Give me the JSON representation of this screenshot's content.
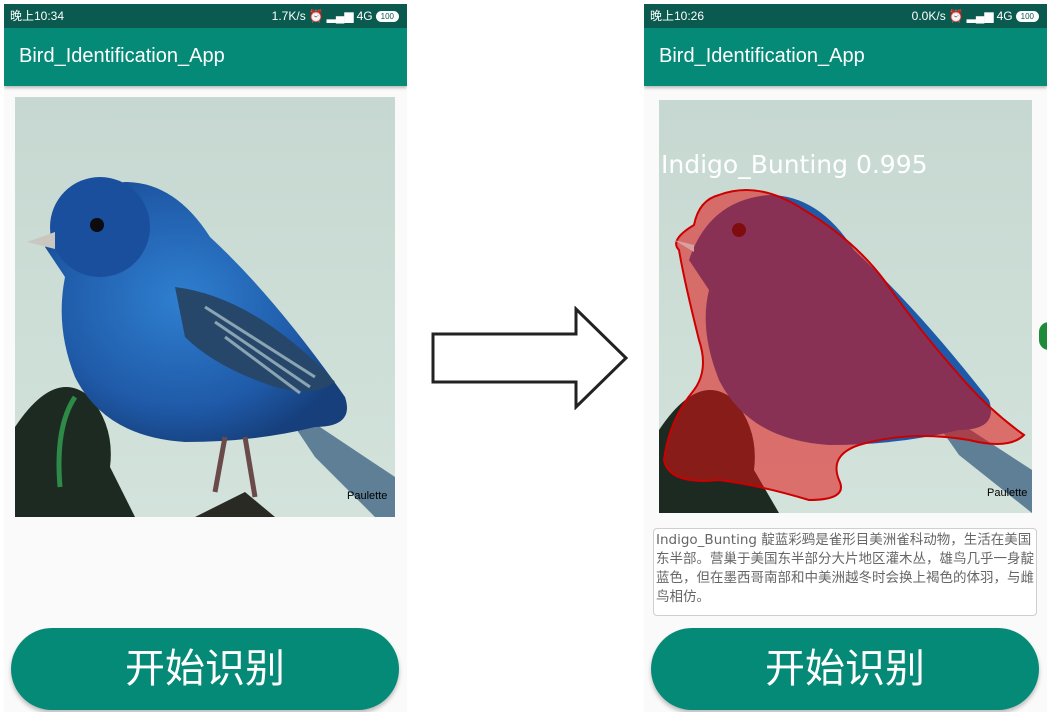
{
  "left_screen": {
    "status": {
      "time": "晚上10:34",
      "speed": "1.7K/s",
      "network": "4G",
      "battery": "100"
    },
    "app_title": "Bird_Identification_App",
    "photo": {
      "watermark": "Paulette"
    },
    "button_label": "开始识别"
  },
  "right_screen": {
    "status": {
      "time": "晚上10:26",
      "speed": "0.0K/s",
      "network": "4G",
      "battery": "100"
    },
    "app_title": "Bird_Identification_App",
    "photo": {
      "watermark": "Paulette"
    },
    "detection": {
      "label": "Indigo_Bunting 0.995",
      "mask_color": "#e01010"
    },
    "description": "Indigo_Bunting 靛蓝彩鹀是雀形目美洲雀科动物，生活在美国东半部。营巢于美国东半部分大片地区灌木丛，雄鸟几乎一身靛蓝色，但在墨西哥南部和中美洲越冬时会换上褐色的体羽，与雌鸟相仿。",
    "button_label": "开始识别"
  },
  "colors": {
    "app_bar": "#068a78",
    "status_bar": "#0b5a4f",
    "button": "#068a78"
  },
  "icons": [
    "alarm-icon",
    "signal-icon",
    "battery-icon",
    "right-arrow-icon"
  ]
}
